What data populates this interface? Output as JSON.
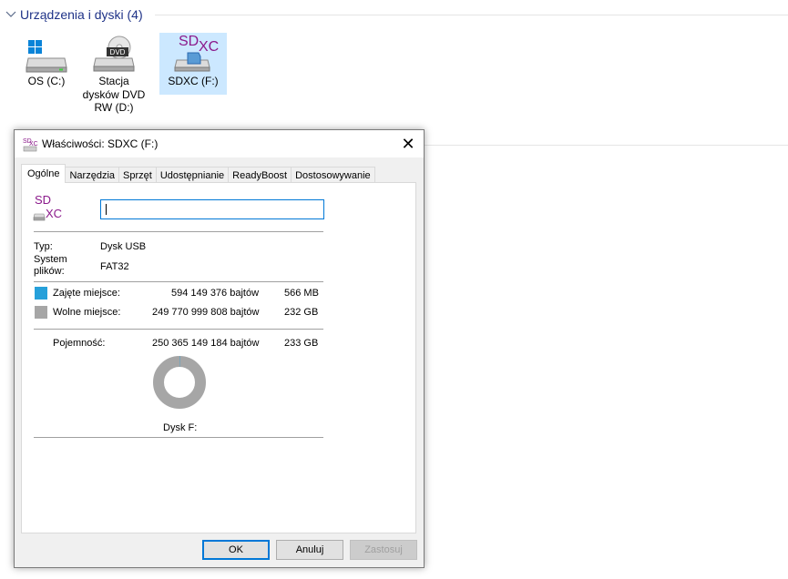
{
  "explorer": {
    "group_title": "Urządzenia i dyski (4)",
    "drives": [
      {
        "label": "OS (C:)",
        "icon": "windows-drive-icon"
      },
      {
        "label": "Stacja dysków DVD RW (D:)",
        "icon": "dvd-drive-icon"
      },
      {
        "label": "SDXC (F:)",
        "icon": "sdxc-drive-icon"
      }
    ]
  },
  "dialog": {
    "title": "Właściwości: SDXC (F:)",
    "close_glyph": "✕",
    "tabs": [
      "Ogólne",
      "Narzędzia",
      "Sprzęt",
      "Udostępnianie",
      "ReadyBoost",
      "Dostosowywanie"
    ],
    "active_tab": "Ogólne",
    "name_value": "",
    "type_label": "Typ:",
    "type_value": "Dysk USB",
    "fs_label": "System plików:",
    "fs_value": "FAT32",
    "used": {
      "label": "Zajęte miejsce:",
      "bytes": "594 149 376 bajtów",
      "size": "566 MB",
      "color": "#26a0da"
    },
    "free": {
      "label": "Wolne miejsce:",
      "bytes": "249 770 999 808 bajtów",
      "size": "232 GB",
      "color": "#a6a6a6"
    },
    "capacity": {
      "label": "Pojemność:",
      "bytes": "250 365 149 184 bajtów",
      "size": "233 GB"
    },
    "used_fraction": 0.0024,
    "disk_label": "Dysk F:",
    "buttons": {
      "ok": "OK",
      "cancel": "Anuluj",
      "apply": "Zastosuj"
    }
  }
}
